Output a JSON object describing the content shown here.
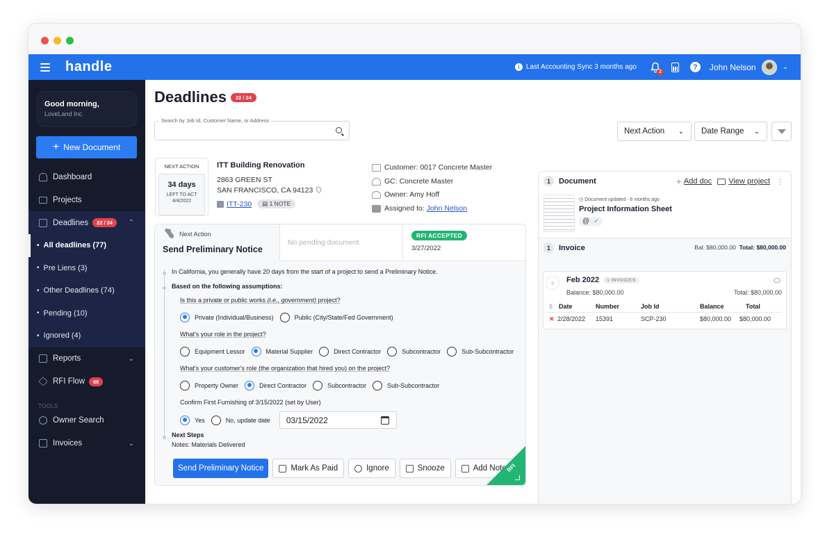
{
  "app": {
    "logo": "handle"
  },
  "topbar": {
    "sync_text": "Last Accounting Sync 3 months ago",
    "notification_count": "2",
    "user_name": "John Nelson"
  },
  "sidebar": {
    "greeting": "Good morning,",
    "company": "LoveLand Inc",
    "new_document": "New Document",
    "items": [
      {
        "label": "Dashboard",
        "icon": "home-icon"
      },
      {
        "label": "Projects",
        "icon": "folder-icon"
      },
      {
        "label": "Deadlines",
        "icon": "calendar-icon",
        "badge": "22 / 24"
      }
    ],
    "deadline_subitems": [
      {
        "label": "All deadlines (77)",
        "active": true
      },
      {
        "label": "Pre Liens (3)"
      },
      {
        "label": "Other Deadlines (74)"
      },
      {
        "label": "Pending (10)"
      },
      {
        "label": "Ignored (4)"
      }
    ],
    "reports": "Reports",
    "rfi_flow": "RFI Flow",
    "rfi_badge": "66",
    "tools_heading": "TOOLS",
    "owner_search": "Owner Search",
    "invoices": "Invoices"
  },
  "main": {
    "title": "Deadlines",
    "title_badge": "22 / 24",
    "search_label": "Search by Job Id, Customer Name, or Address",
    "search_value": "",
    "filter_next_action": "Next Action",
    "filter_date_range": "Date Range"
  },
  "deadline_card": {
    "next_action_heading": "NEXT ACTION",
    "days": "34 days",
    "left_to_act": "LEFT TO ACT",
    "due_date": "4/4/2022",
    "project_name": "ITT Building Renovation",
    "address_line1": "2863 GREEN ST",
    "address_line2": "SAN FRANCISCO, CA 94123",
    "job_id": "ITT-230",
    "notes_chip": "1 NOTE",
    "customer": "Customer: 0017 Concrete Master",
    "gc": "GC: Concrete Master",
    "owner": "Owner: Amy Hoff",
    "assigned_label": "Assigned to:",
    "assigned_to": "John Nelson",
    "tab_next_action_label": "Next Action",
    "tab_next_action_value": "Send Preliminary Notice",
    "tab_pending": "No pending document",
    "rfi_status": "RFI ACCEPTED",
    "rfi_date": "3/27/2022",
    "info_line": "In California, you generally have 20 days from the start of a project to send a Preliminary Notice.",
    "assumptions_heading": "Based on the following assumptions:",
    "q1_pre": "Is this a private or public works ",
    "q1_italic": "(i.e., government)",
    "q1_post": " project?",
    "q1_options": [
      {
        "label": "Private (Individual/Business)",
        "selected": true
      },
      {
        "label": "Public (City/State/Fed Government)",
        "selected": false
      }
    ],
    "q2": "What's your role in the project?",
    "q2_options": [
      {
        "label": "Equipment Lessor",
        "selected": false
      },
      {
        "label": "Material Supplier",
        "selected": true
      },
      {
        "label": "Direct Contractor",
        "selected": false
      },
      {
        "label": "Subcontractor",
        "selected": false
      },
      {
        "label": "Sub-Subcontractor",
        "selected": false
      }
    ],
    "q3": "What's your customer's role (the organization that hired you) on the project?",
    "q3_options": [
      {
        "label": "Property Owner",
        "selected": false
      },
      {
        "label": "Direct Contractor",
        "selected": true
      },
      {
        "label": "Subcontractor",
        "selected": false
      },
      {
        "label": "Sub-Subcontractor",
        "selected": false
      }
    ],
    "q4": "Confirm First Furnishing of 3/15/2022 (set by User)",
    "q4_options": [
      {
        "label": "Yes",
        "selected": true
      },
      {
        "label": "No, update date",
        "selected": false
      }
    ],
    "furnishing_date": "03/15/2022",
    "next_steps_heading": "Next Steps",
    "notes": "Notes: Materials Delivered",
    "buttons": {
      "send": "Send Preliminary Notice",
      "mark_paid": "Mark As Paid",
      "ignore": "Ignore",
      "snooze": "Snooze",
      "add_notes": "Add Notes"
    },
    "corner_tag": "RFI"
  },
  "right_panel": {
    "doc_count": "1",
    "doc_heading": "Document",
    "add_doc": "Add doc",
    "view_project": "View project",
    "doc_updated": "Document updated - 6 months ago",
    "doc_name": "Project Information Sheet",
    "inv_count": "1",
    "inv_heading": "Invoice",
    "inv_bal": "Bal: $80,000.00",
    "inv_total": "Total: $80,000.00",
    "group": {
      "month": "Feb 2022",
      "count_chip": "1 INVOICES",
      "balance": "Balance: $80,000.00",
      "total": "Total: $80,000.00",
      "columns": [
        "Date",
        "Number",
        "Job Id",
        "Balance",
        "Total"
      ],
      "rows": [
        {
          "date": "2/28/2022",
          "number": "15391",
          "job_id": "SCP-230",
          "balance": "$80,000.00",
          "total": "$80,000.00"
        }
      ]
    }
  }
}
